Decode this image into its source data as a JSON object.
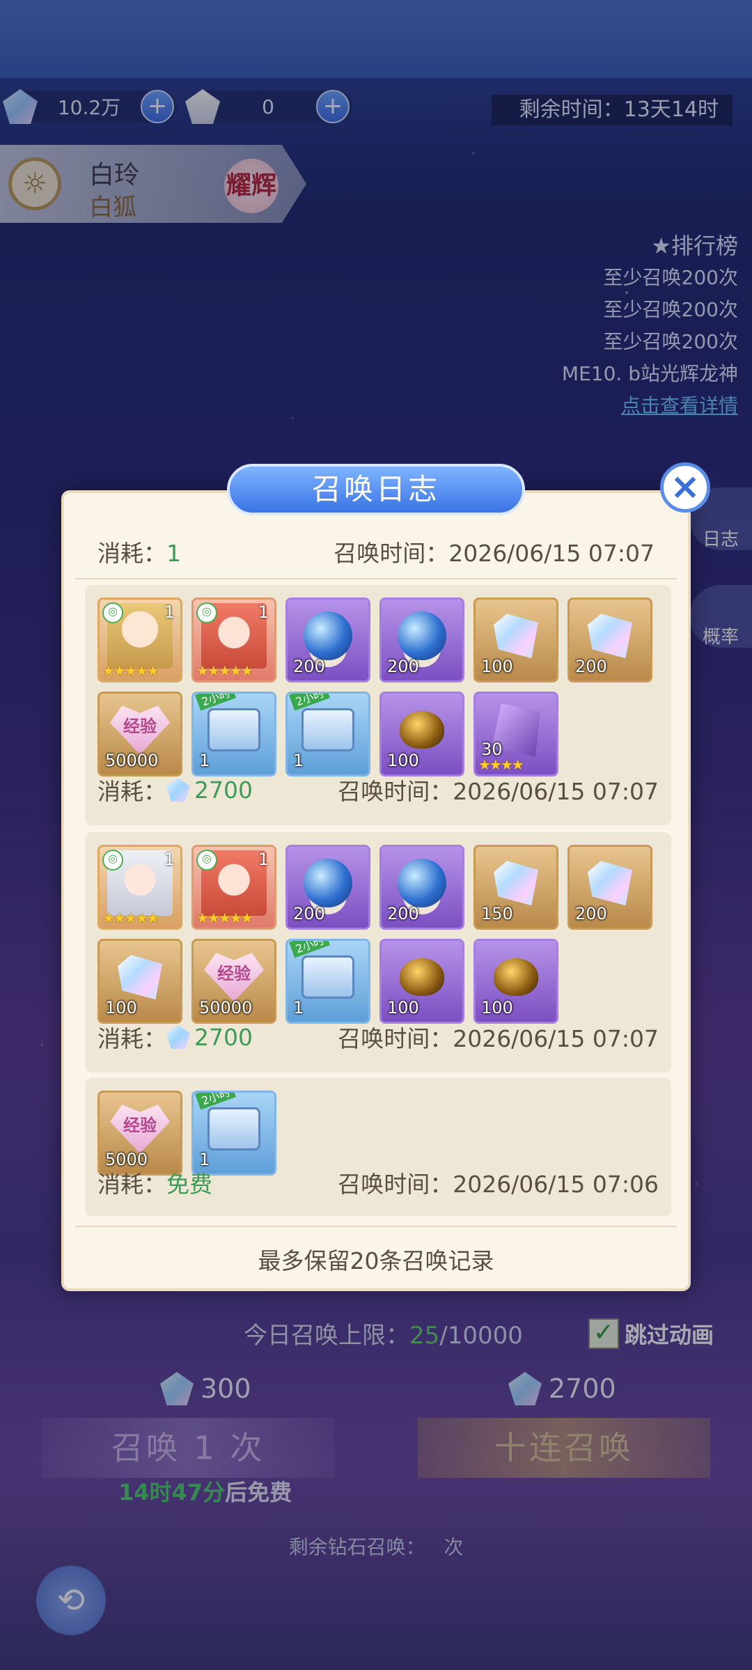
{
  "header": {
    "diamonds": "10.2万",
    "dress": "0",
    "timer_label": "剩余时间：",
    "timer_value": "13天14时"
  },
  "character": {
    "name": "白玲",
    "alias": "白狐",
    "tag": "耀辉"
  },
  "ranking": {
    "title": "排行榜",
    "entries": [
      "至少召唤200次",
      "至少召唤200次",
      "至少召唤200次"
    ],
    "me_prefix": "ME10.",
    "me_name": "b站光辉龙神",
    "link": "点击查看详情"
  },
  "side_buttons": [
    "日志",
    "概率"
  ],
  "dialog": {
    "title": "召唤日志",
    "top_cost_label": "消耗：",
    "top_cost_value": "1",
    "top_time": "召唤时间：2026/06/15 07:07",
    "records": [
      {
        "items": [
          {
            "type": "hero",
            "count": "1",
            "stars": "★★★★★"
          },
          {
            "type": "hero2",
            "count": "1",
            "stars": "★★★★★"
          },
          {
            "type": "orb",
            "count": "200"
          },
          {
            "type": "orb",
            "count": "200"
          },
          {
            "type": "crystal",
            "count": "100"
          },
          {
            "type": "crystal",
            "count": "200"
          },
          {
            "type": "exp",
            "count": "50000",
            "label": "经验"
          },
          {
            "type": "chest",
            "count": "1",
            "ribbon": "2小时"
          },
          {
            "type": "chest",
            "count": "1",
            "ribbon": "2小时"
          },
          {
            "type": "egg",
            "count": "100"
          },
          {
            "type": "shard",
            "count": "30",
            "stars": "★★★★"
          }
        ],
        "cost_label": "消耗：",
        "cost": "2700",
        "time": "召唤时间：2026/06/15 07:07"
      },
      {
        "items": [
          {
            "type": "hero3",
            "count": "1",
            "stars": "★★★★★"
          },
          {
            "type": "hero2",
            "count": "1",
            "stars": "★★★★★"
          },
          {
            "type": "orb",
            "count": "200"
          },
          {
            "type": "orb",
            "count": "200"
          },
          {
            "type": "crystal",
            "count": "150"
          },
          {
            "type": "crystal",
            "count": "200"
          },
          {
            "type": "crystal",
            "count": "100"
          },
          {
            "type": "exp",
            "count": "50000",
            "label": "经验"
          },
          {
            "type": "chest",
            "count": "1",
            "ribbon": "2小时"
          },
          {
            "type": "egg",
            "count": "100"
          },
          {
            "type": "egg",
            "count": "100"
          }
        ],
        "cost_label": "消耗：",
        "cost": "2700",
        "time": "召唤时间：2026/06/15 07:07"
      },
      {
        "items": [
          {
            "type": "exp",
            "count": "5000",
            "label": "经验"
          },
          {
            "type": "chest",
            "count": "1",
            "ribbon": "2小时"
          }
        ],
        "cost_label": "消耗：",
        "cost": "免费",
        "time": "召唤时间：2026/06/15 07:06"
      }
    ],
    "note": "最多保留20条召唤记录"
  },
  "bottom": {
    "limit_label": "今日召唤上限：",
    "limit_used": "25",
    "limit_total": "/10000",
    "skip_label": "跳过动画",
    "cost_single": "300",
    "cost_ten": "2700",
    "btn_single": "召唤 1 次",
    "btn_ten": "十连召唤",
    "free_time": "14时47分",
    "free_suffix": "后免费",
    "remain_prefix": "剩余钻石召唤：",
    "remain_suffix": "次"
  },
  "colors": {
    "accent_blue": "#3a73e6",
    "green": "#3e9b55",
    "panel": "#faf5e8"
  }
}
